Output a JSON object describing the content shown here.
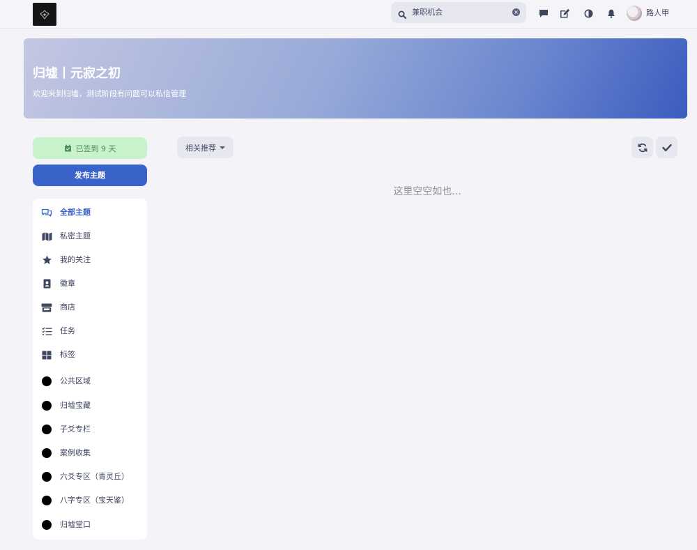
{
  "header": {
    "search_value": "兼职机会",
    "username": "路人甲",
    "icons": [
      "logo-icon",
      "search-icon",
      "clear-icon",
      "message-icon",
      "compose-icon",
      "theme-toggle-icon",
      "bell-icon"
    ]
  },
  "hero": {
    "title": "归墟丨元寂之初",
    "subtitle": "欢迎来到归墟，测试阶段有问题可以私信管理"
  },
  "actions": {
    "checkin_label": "已签到 9 天",
    "publish_label": "发布主题"
  },
  "sidebar": {
    "items": [
      {
        "label": "全部主题",
        "icon": "comments-icon",
        "active": true
      },
      {
        "label": "私密主题",
        "icon": "map-icon"
      },
      {
        "label": "我的关注",
        "icon": "star-icon"
      },
      {
        "label": "徽章",
        "icon": "badge-icon"
      },
      {
        "label": "商店",
        "icon": "store-icon"
      },
      {
        "label": "任务",
        "icon": "tasks-icon"
      },
      {
        "label": "标签",
        "icon": "tags-icon"
      },
      {
        "label": "公共区域",
        "icon": "tag-dot-icon"
      },
      {
        "label": "归墟宝藏",
        "icon": "tag-dot-icon"
      },
      {
        "label": "子爻专栏",
        "icon": "tag-dot-icon"
      },
      {
        "label": "案例收集",
        "icon": "tag-dot-icon"
      },
      {
        "label": "六爻专区（青灵丘）",
        "icon": "tag-dot-icon"
      },
      {
        "label": "八字专区（宝天鉴）",
        "icon": "tag-dot-icon"
      },
      {
        "label": "归墟堂口",
        "icon": "tag-dot-icon"
      }
    ]
  },
  "main": {
    "sort_label": "相关推荐",
    "empty_text": "这里空空如也..."
  },
  "colors": {
    "accent": "#3a63c9",
    "checkin_bg": "#c8f2cc",
    "checkin_text": "#4f8f55",
    "icon": "#3e4660",
    "background": "#f3f3f8"
  }
}
